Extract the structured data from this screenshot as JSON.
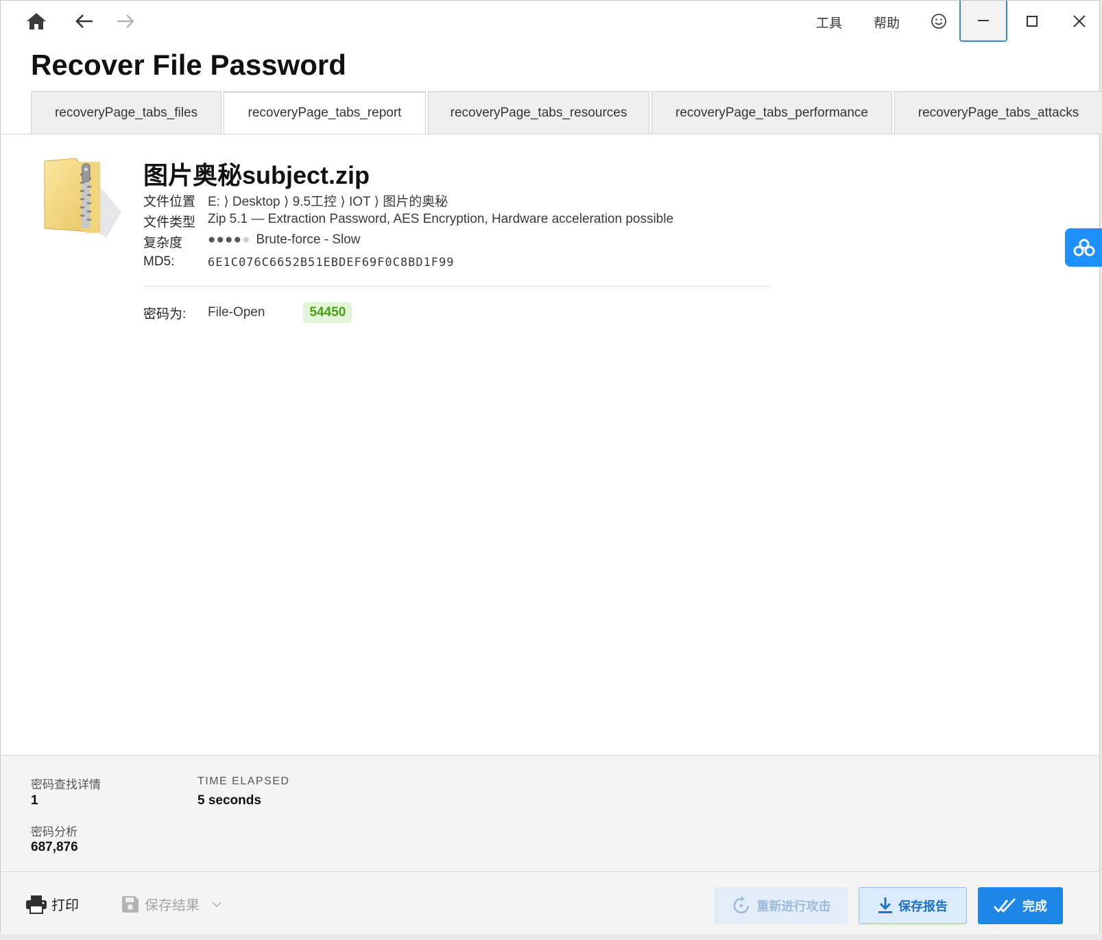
{
  "window": {
    "menu": {
      "tools": "工具",
      "help": "帮助"
    }
  },
  "page": {
    "title": "Recover File Password"
  },
  "tabs": [
    {
      "label": "recoveryPage_tabs_files"
    },
    {
      "label": "recoveryPage_tabs_report"
    },
    {
      "label": "recoveryPage_tabs_resources"
    },
    {
      "label": "recoveryPage_tabs_performance"
    },
    {
      "label": "recoveryPage_tabs_attacks"
    }
  ],
  "active_tab": "recoveryPage_tabs_report",
  "report": {
    "file_name": "图片奥秘subject.zip",
    "location_label": "文件位置",
    "location_value": "E: ⟩ Desktop ⟩ 9.5工控 ⟩ IOT ⟩ 图片的奥秘",
    "type_label": "文件类型",
    "type_value": "Zip 5.1 — Extraction Password, AES Encryption, Hardware acceleration possible",
    "complexity_label": "复杂度",
    "complexity_level": 4,
    "complexity_max": 5,
    "complexity_value": "Brute-force - Slow",
    "md5_label": "MD5:",
    "md5_value": "6E1C076C6652B51EBDEF69F0C8BD1F99",
    "password_label": "密码为:",
    "password_type": "File-Open",
    "password_value": "54450"
  },
  "stats": {
    "found_label": "密码查找详情",
    "found_value": "1",
    "time_label": "TIME ELAPSED",
    "time_value": "5 seconds",
    "analysis_label": "密码分析",
    "analysis_value": "687,876"
  },
  "footer": {
    "print_label": "打印",
    "save_results_label": "保存结果",
    "retry_label": "重新进行攻击",
    "save_report_label": "保存报告",
    "done_label": "完成"
  },
  "colors": {
    "accent": "#1e86e6",
    "password_badge_bg": "#e3f3d6",
    "password_badge_text": "#4b9d1a",
    "side_widget": "#1e90ff"
  },
  "icons": [
    "home-icon",
    "back-arrow-icon",
    "forward-arrow-icon",
    "smiley-icon",
    "minimize-icon",
    "maximize-icon",
    "close-icon",
    "zip-folder-icon",
    "cloud-widget-icon",
    "printer-icon",
    "floppy-disk-icon",
    "chevron-down-icon",
    "retry-icon",
    "download-icon",
    "double-check-icon"
  ]
}
